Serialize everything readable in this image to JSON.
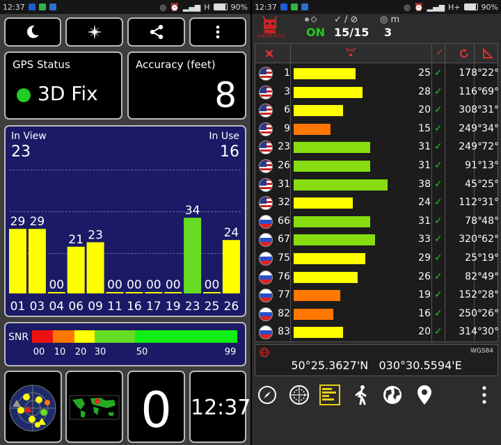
{
  "left": {
    "status_bar": {
      "time": "12:37",
      "network": "H",
      "battery": "90%"
    },
    "gps_status": {
      "label": "GPS Status",
      "fix": "3D Fix",
      "fix_color": "#22cc22"
    },
    "accuracy": {
      "label": "Accuracy (feet)",
      "value": "8"
    },
    "satellites": {
      "in_view_label": "In View",
      "in_view": "23",
      "in_use_label": "In Use",
      "in_use": "16",
      "bar_color_low": "#ffff00",
      "bar_color_high": "#66dd22",
      "bars": [
        {
          "prn": "01",
          "snr": 29
        },
        {
          "prn": "03",
          "snr": 29
        },
        {
          "prn": "04",
          "snr": 0
        },
        {
          "prn": "06",
          "snr": 21
        },
        {
          "prn": "09",
          "snr": 23
        },
        {
          "prn": "11",
          "snr": 0
        },
        {
          "prn": "16",
          "snr": 0
        },
        {
          "prn": "17",
          "snr": 0
        },
        {
          "prn": "19",
          "snr": 0
        },
        {
          "prn": "23",
          "snr": 34
        },
        {
          "prn": "25",
          "snr": 0
        },
        {
          "prn": "26",
          "snr": 24
        }
      ]
    },
    "snr_scale": {
      "label": "SNR",
      "ticks": [
        "00",
        "10",
        "20",
        "30",
        "50",
        "99"
      ]
    },
    "bottom": {
      "zero": "0",
      "clock": "12:37"
    }
  },
  "right": {
    "status_bar": {
      "time": "12:37",
      "network": "H+",
      "battery": "90%"
    },
    "logo": "ANDROITS",
    "gps_state": "ON",
    "sats_ratio": "15/15",
    "count": "3",
    "rows": [
      {
        "prn": "1",
        "country": "us",
        "snr": 25,
        "az": "178°",
        "el": "22°",
        "color": "#ffff00"
      },
      {
        "prn": "3",
        "country": "us",
        "snr": 28,
        "az": "116°",
        "el": "69°",
        "color": "#ffff00"
      },
      {
        "prn": "6",
        "country": "us",
        "snr": 20,
        "az": "308°",
        "el": "31°",
        "color": "#ffff00"
      },
      {
        "prn": "9",
        "country": "us",
        "snr": 15,
        "az": "249°",
        "el": "34°",
        "color": "#ff7700"
      },
      {
        "prn": "23",
        "country": "us",
        "snr": 31,
        "az": "249°",
        "el": "72°",
        "color": "#88dd11"
      },
      {
        "prn": "26",
        "country": "us",
        "snr": 31,
        "az": "91°",
        "el": "13°",
        "color": "#88dd11"
      },
      {
        "prn": "31",
        "country": "us",
        "snr": 38,
        "az": "45°",
        "el": "25°",
        "color": "#88dd11"
      },
      {
        "prn": "32",
        "country": "us",
        "snr": 24,
        "az": "112°",
        "el": "31°",
        "color": "#ffff00"
      },
      {
        "prn": "66",
        "country": "ru",
        "snr": 31,
        "az": "78°",
        "el": "48°",
        "color": "#88dd11"
      },
      {
        "prn": "67",
        "country": "ru",
        "snr": 33,
        "az": "320°",
        "el": "62°",
        "color": "#88dd11"
      },
      {
        "prn": "75",
        "country": "ru",
        "snr": 29,
        "az": "25°",
        "el": "19°",
        "color": "#ffff00"
      },
      {
        "prn": "76",
        "country": "ru",
        "snr": 26,
        "az": "82°",
        "el": "49°",
        "color": "#ffff00"
      },
      {
        "prn": "77",
        "country": "ru",
        "snr": 19,
        "az": "152°",
        "el": "28°",
        "color": "#ff7700"
      },
      {
        "prn": "82",
        "country": "ru",
        "snr": 16,
        "az": "250°",
        "el": "26°",
        "color": "#ff7700"
      },
      {
        "prn": "83",
        "country": "ru",
        "snr": 20,
        "az": "314°",
        "el": "30°",
        "color": "#ffff00"
      }
    ],
    "datum": "WGS84",
    "lat": "50°25.3627'N",
    "lon": "030°30.5594'E"
  }
}
